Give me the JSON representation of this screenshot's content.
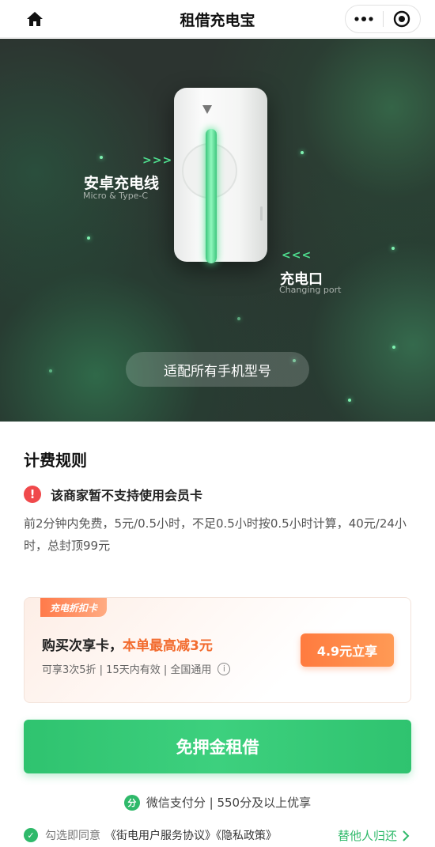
{
  "nav": {
    "title": "租借充电宝",
    "home_icon": "home-icon",
    "more_icon": "more-dots-icon",
    "close_icon": "target-close-icon"
  },
  "hero": {
    "android_label": "安卓充电线",
    "android_sub": "Micro & Type-C",
    "android_arrows": ">>>",
    "port_label": "充电口",
    "port_sub": "Changing port",
    "port_arrows": "<<<",
    "pill_text": "适配所有手机型号"
  },
  "fee": {
    "title": "计费规则",
    "warning": "该商家暂不支持使用会员卡",
    "description": "前2分钟内免费，5元/0.5小时，不足0.5小时按0.5小时计算，40元/24小时，总封顶99元"
  },
  "promo": {
    "tag": "充电折扣卡",
    "headline_prefix": "购买次享卡，",
    "headline_highlight": "本单最高减3元",
    "subline": "可享3次5折 | 15天内有效 | 全国通用",
    "button": "4.9元立享",
    "accent": "#f26b2e"
  },
  "main_button": "免押金租借",
  "score": {
    "text": "微信支付分 | 550分及以上优享"
  },
  "agree": {
    "prefix": "勾选即同意",
    "link": "《街电用户服务协议》《隐私政策》",
    "help": "替他人归还"
  },
  "colors": {
    "brand_green": "#2fc36f",
    "warning_red": "#f0494b"
  }
}
